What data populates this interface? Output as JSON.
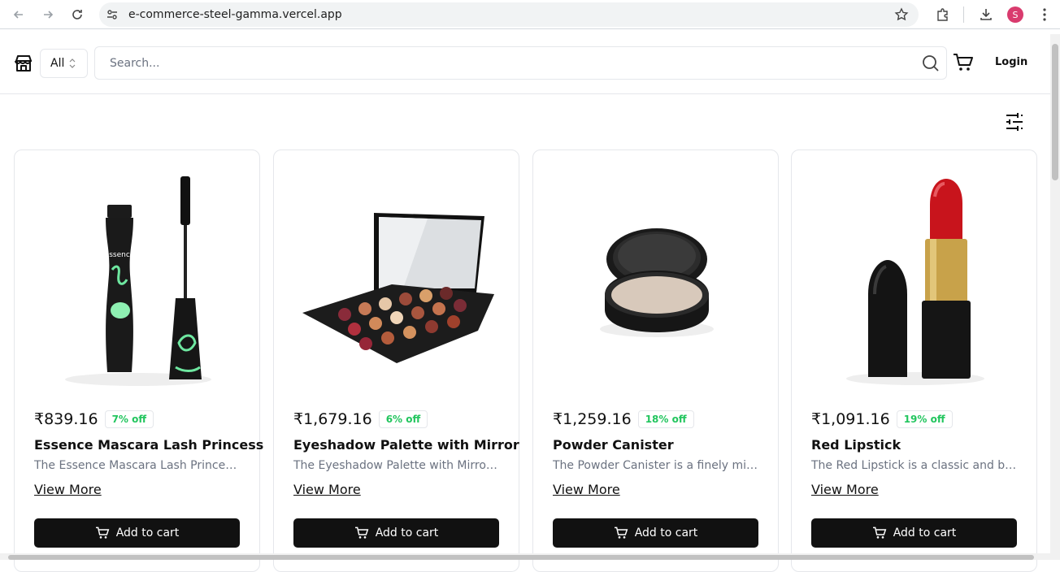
{
  "browser": {
    "url": "e-commerce-steel-gamma.vercel.app",
    "profile_initial": "S"
  },
  "header": {
    "category_select": "All",
    "search_placeholder": "Search...",
    "login_label": "Login"
  },
  "products": [
    {
      "price": "₹839.16",
      "discount": "7% off",
      "title": "Essence Mascara Lash Princess",
      "description": "The Essence Mascara Lash Princess is …",
      "view_more": "View More",
      "add_to_cart": "Add to cart",
      "image": "mascara",
      "brand_text": "essence"
    },
    {
      "price": "₹1,679.16",
      "discount": "6% off",
      "title": "Eyeshadow Palette with Mirror",
      "description": "The Eyeshadow Palette with Mirror…",
      "view_more": "View More",
      "add_to_cart": "Add to cart",
      "image": "eyeshadow-palette"
    },
    {
      "price": "₹1,259.16",
      "discount": "18% off",
      "title": "Powder Canister",
      "description": "The Powder Canister is a finely milled…",
      "view_more": "View More",
      "add_to_cart": "Add to cart",
      "image": "powder-compact"
    },
    {
      "price": "₹1,091.16",
      "discount": "19% off",
      "title": "Red Lipstick",
      "description": "The Red Lipstick is a classic and bold…",
      "view_more": "View More",
      "add_to_cart": "Add to cart",
      "image": "lipstick"
    }
  ],
  "colors": {
    "badge_text": "#22c55e",
    "button_bg": "#111111",
    "avatar_bg": "#d93b6e"
  }
}
